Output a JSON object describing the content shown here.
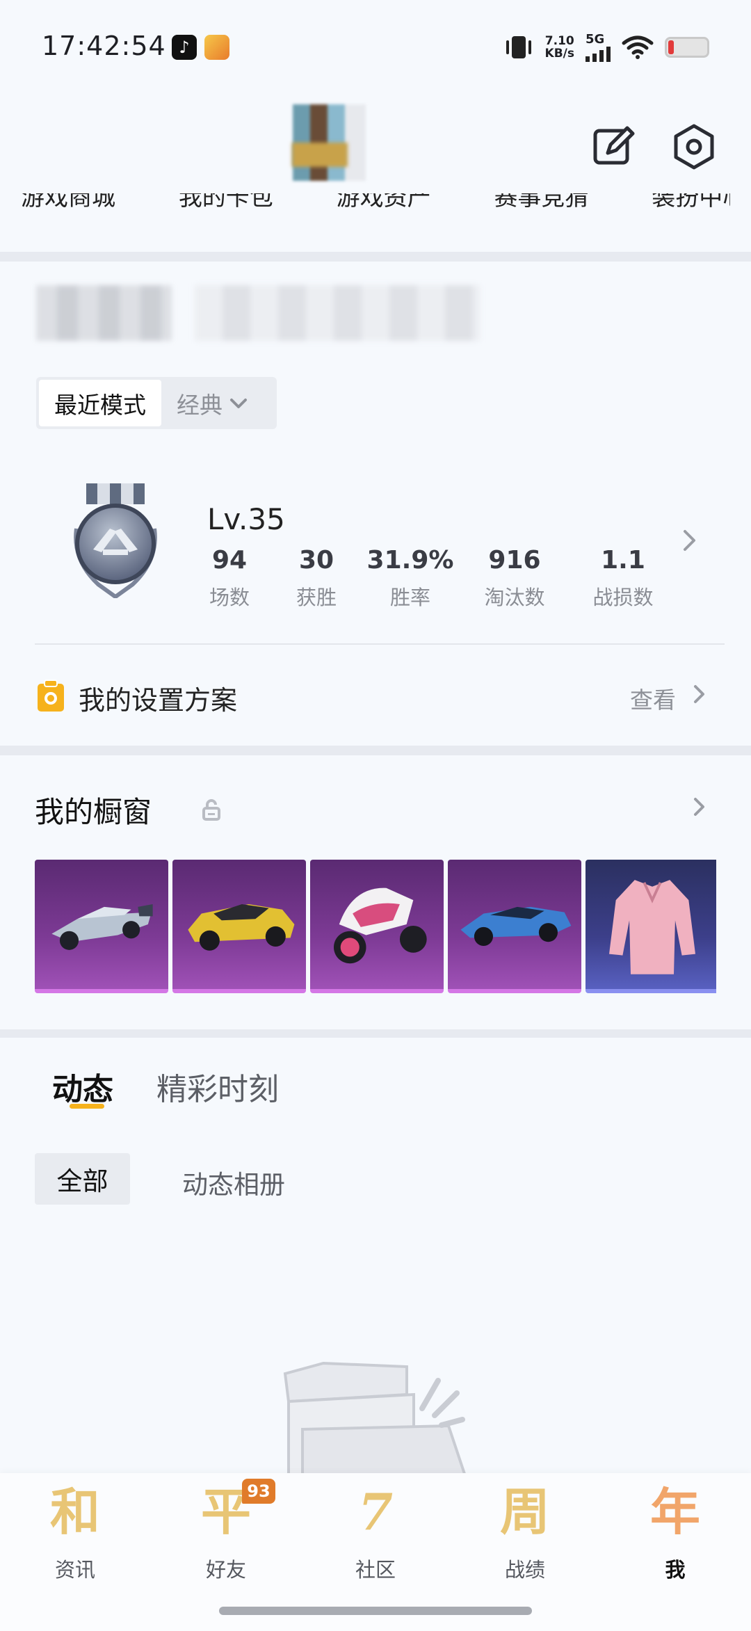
{
  "status_bar": {
    "time": "17:42:54",
    "net_speed_value": "7.10",
    "net_speed_unit": "KB/s",
    "network": "5G"
  },
  "header": {
    "cut_off_menu": [
      "游戏商城",
      "我的卡包",
      "游戏资产",
      "赛事竞猜",
      "装扮中心"
    ]
  },
  "mode": {
    "recent_label": "最近模式",
    "classic_label": "经典"
  },
  "stats": {
    "level": "Lv.35",
    "items": [
      {
        "value": "94",
        "label": "场数"
      },
      {
        "value": "30",
        "label": "获胜"
      },
      {
        "value": "31.9%",
        "label": "胜率"
      },
      {
        "value": "916",
        "label": "淘汰数"
      },
      {
        "value": "1.1",
        "label": "战损数"
      }
    ]
  },
  "settings_plan": {
    "label": "我的设置方案",
    "view_label": "查看"
  },
  "showcase": {
    "title": "我的橱窗"
  },
  "tabs": {
    "active": "动态",
    "inactive": "精彩时刻"
  },
  "filters": {
    "all": "全部",
    "album": "动态相册"
  },
  "bottom_nav": {
    "items": [
      {
        "glyph": "和",
        "label": "资讯"
      },
      {
        "glyph": "平",
        "label": "好友",
        "badge": "93"
      },
      {
        "glyph": "7",
        "label": "社区"
      },
      {
        "glyph": "周",
        "label": "战绩"
      },
      {
        "glyph": "年",
        "label": "我"
      }
    ]
  },
  "colors": {
    "accent": "#f6b21c",
    "nav_glyph": "#e8c575",
    "badge": "#e07b2a",
    "showcase_purple": "#7d3a95"
  }
}
